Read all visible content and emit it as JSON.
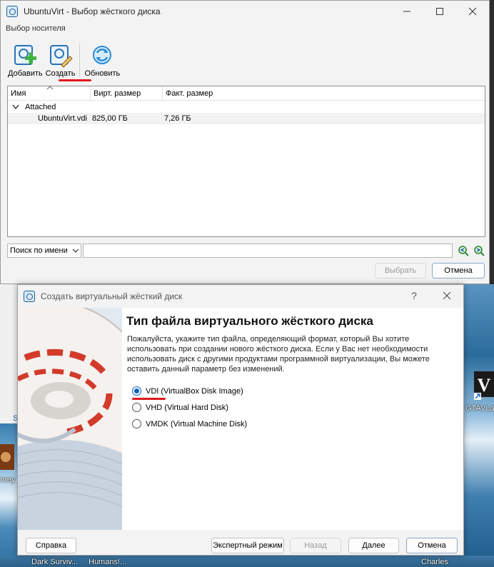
{
  "desktop": {
    "labels": {
      "gta": "GTAVLa",
      "charles": "Charles",
      "dark": "Dark Surviv...",
      "humans": "Humans!...",
      "rney": "rney",
      "s": "S"
    }
  },
  "disk_selector": {
    "title": "UbuntuVirt - Выбор жёсткого диска",
    "menu_label": "Выбор носителя",
    "toolbar": {
      "add": "Добавить",
      "create": "Создать",
      "refresh": "Обновить"
    },
    "columns": {
      "name": "Имя",
      "virtual_size": "Вирт. размер",
      "actual_size": "Факт. размер"
    },
    "group": "Attached",
    "rows": [
      {
        "name": "UbuntuVirt.vdi",
        "virtual_size": "825,00 ГБ",
        "actual_size": "7,26 ГБ"
      }
    ],
    "search_mode": "Поиск по имени",
    "search_value": "",
    "buttons": {
      "choose": "Выбрать",
      "cancel": "Отмена"
    }
  },
  "wizard": {
    "title": "Создать виртуальный жёсткий диск",
    "help_glyph": "?",
    "heading": "Тип файла виртуального жёсткого диска",
    "description": "Пожалуйста, укажите тип файла, определяющий формат, который Вы хотите использовать при создании нового жёсткого диска. Если у Вас нет необходимости использовать диск с другими продуктами программной виртуализации, Вы можете оставить данный параметр без изменений.",
    "options": [
      {
        "label": "VDI (VirtualBox Disk Image)",
        "checked": true
      },
      {
        "label": "VHD (Virtual Hard Disk)",
        "checked": false
      },
      {
        "label": "VMDK (Virtual Machine Disk)",
        "checked": false
      }
    ],
    "buttons": {
      "help": "Справка",
      "expert": "Экспертный режим",
      "back": "Назад",
      "next": "Далее",
      "cancel": "Отмена"
    }
  },
  "colors": {
    "accent_red": "#e0191f",
    "radio_blue": "#0a5ec9"
  }
}
